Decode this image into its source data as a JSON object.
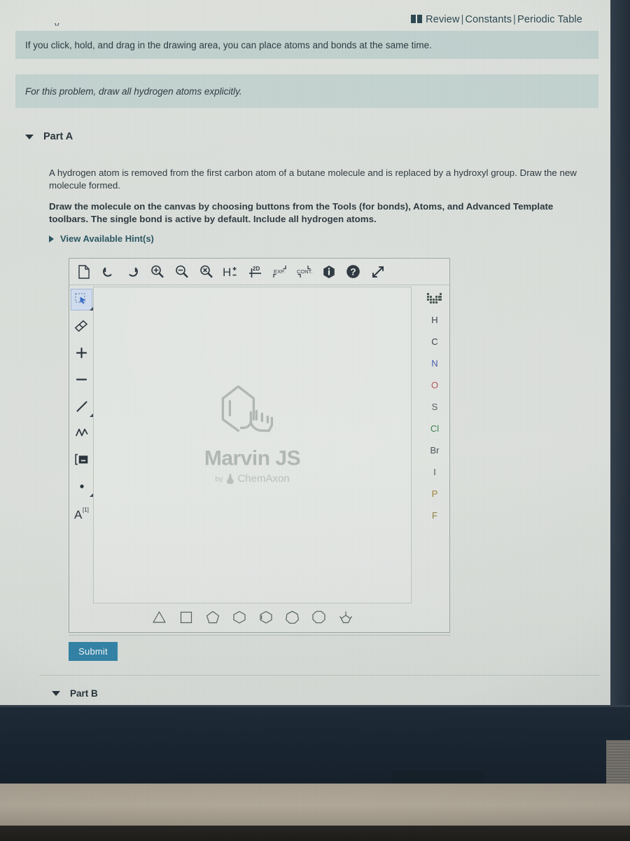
{
  "header": {
    "book_icon": "book-icon",
    "links": [
      {
        "label": "Review"
      },
      {
        "label": "Constants"
      },
      {
        "label": "Periodic Table"
      }
    ],
    "separator": "|"
  },
  "banners": [
    {
      "id": "tip",
      "text": "If you click, hold, and drag in the drawing area, you can place atoms and bonds at the same time."
    },
    {
      "id": "note",
      "text": "For this problem, draw all hydrogen atoms explicitly."
    }
  ],
  "clipped_text": "y ,",
  "part_a": {
    "title": "Part A",
    "prompt": "A hydrogen atom is removed from the first carbon atom of a butane molecule and is replaced by a hydroxyl group. Draw the new molecule formed.",
    "instructions": "Draw the molecule on the canvas by choosing buttons from the Tools (for bonds), Atoms, and Advanced Template toolbars. The single bond is active by default. Include all hydrogen atoms.",
    "hint_label": "View Available Hint(s)",
    "submit_label": "Submit"
  },
  "part_b": {
    "title": "Part B"
  },
  "editor": {
    "name": "Marvin JS",
    "watermark_title": "Marvin JS",
    "watermark_by": "by",
    "watermark_vendor": "ChemAxon",
    "toolbar": [
      {
        "name": "new-file-icon",
        "label": "New"
      },
      {
        "name": "undo-icon",
        "label": "Undo"
      },
      {
        "name": "redo-icon",
        "label": "Redo"
      },
      {
        "name": "zoom-in-icon",
        "label": "Zoom In"
      },
      {
        "name": "zoom-out-icon",
        "label": "Zoom Out"
      },
      {
        "name": "zoom-reset-icon",
        "label": "Reset Zoom"
      },
      {
        "name": "hydrogen-toggle-icon",
        "label": "H±"
      },
      {
        "name": "clean-2d-icon",
        "label": "2D"
      },
      {
        "name": "explicit-icon",
        "label": "EXP."
      },
      {
        "name": "contracted-icon",
        "label": "CONT."
      },
      {
        "name": "about-icon",
        "label": "About"
      },
      {
        "name": "help-icon",
        "label": "Help"
      },
      {
        "name": "fullscreen-icon",
        "label": "Fullscreen"
      }
    ],
    "tools": [
      {
        "name": "selection-tool-icon",
        "label": "Rectangle Selection",
        "active": true,
        "has_submenu": true
      },
      {
        "name": "eraser-tool-icon",
        "label": "Eraser",
        "active": false,
        "has_submenu": false
      },
      {
        "name": "increase-charge-icon",
        "label": "Increase Charge",
        "active": false,
        "has_submenu": false
      },
      {
        "name": "decrease-charge-icon",
        "label": "Decrease Charge",
        "active": false,
        "has_submenu": false
      },
      {
        "name": "single-bond-icon",
        "label": "Single Bond",
        "active": false,
        "has_submenu": true
      },
      {
        "name": "chain-tool-icon",
        "label": "Chain",
        "active": false,
        "has_submenu": false
      },
      {
        "name": "bracket-tool-icon",
        "label": "Bracket",
        "active": false,
        "has_submenu": false
      },
      {
        "name": "radical-tool-icon",
        "label": "Radical",
        "active": false,
        "has_submenu": true
      },
      {
        "name": "atom-label-icon",
        "label": "A[1]",
        "active": false,
        "has_submenu": false
      }
    ],
    "atoms": [
      {
        "symbol": "",
        "name": "periodic-table-icon",
        "color": "#3c4a44"
      },
      {
        "symbol": "H",
        "name": "atom-h",
        "color": "#2c3640"
      },
      {
        "symbol": "C",
        "name": "atom-c",
        "color": "#2c3640"
      },
      {
        "symbol": "N",
        "name": "atom-n",
        "color": "#3b4fa8"
      },
      {
        "symbol": "O",
        "name": "atom-o",
        "color": "#b5484e"
      },
      {
        "symbol": "S",
        "name": "atom-s",
        "color": "#4a5258"
      },
      {
        "symbol": "Cl",
        "name": "atom-cl",
        "color": "#2f7a43"
      },
      {
        "symbol": "Br",
        "name": "atom-br",
        "color": "#3d4750"
      },
      {
        "symbol": "I",
        "name": "atom-i",
        "color": "#4b4453"
      },
      {
        "symbol": "P",
        "name": "atom-p",
        "color": "#9a7a2e"
      },
      {
        "symbol": "F",
        "name": "atom-f",
        "color": "#8d7b3a"
      }
    ],
    "templates": [
      {
        "name": "template-cyclopropane-icon",
        "sides": 3,
        "label": "Cyclopropane"
      },
      {
        "name": "template-cyclobutane-icon",
        "sides": 4,
        "label": "Cyclobutane"
      },
      {
        "name": "template-cyclopentane-icon",
        "sides": 5,
        "label": "Cyclopentane"
      },
      {
        "name": "template-cyclohexane-icon",
        "sides": 6,
        "label": "Cyclohexane"
      },
      {
        "name": "template-cyclohexene-icon",
        "sides": 6,
        "label": "Cyclohexene"
      },
      {
        "name": "template-cycloheptane-icon",
        "sides": 7,
        "label": "Cycloheptane"
      },
      {
        "name": "template-cyclooctane-icon",
        "sides": 8,
        "label": "Cyclooctane"
      },
      {
        "name": "template-advanced-icon",
        "sides": 0,
        "label": "Advanced Template"
      }
    ]
  },
  "colors": {
    "accent": "#2b7da3",
    "banner_bg": "#bfd0cd",
    "link": "#1c4a58",
    "page_bg": "#d9ddd9",
    "bezel": "#101c29"
  }
}
